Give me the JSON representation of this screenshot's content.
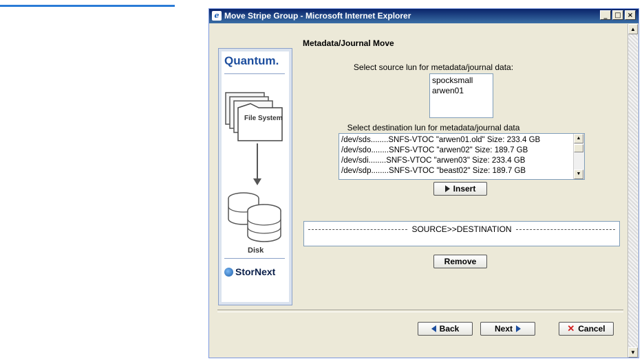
{
  "window": {
    "title": "Move Stripe Group - Microsoft Internet Explorer",
    "controls": {
      "minimize": "_",
      "maximize": "□",
      "close": "×"
    }
  },
  "sidebar": {
    "logo": "Quantum.",
    "file_system_label": "File System",
    "disk_label": "Disk",
    "brand": "StorNext"
  },
  "main": {
    "section_title": "Metadata/Journal Move",
    "source_label": "Select source lun for metadata/journal data:",
    "source_items": [
      "spocksmall",
      "arwen01"
    ],
    "destination_label": "Select destination lun for metadata/journal data",
    "destination_items": [
      "/dev/sds........SNFS-VTOC \"arwen01.old\" Size: 233.4 GB",
      "/dev/sdo........SNFS-VTOC \"arwen02\" Size: 189.7 GB",
      "/dev/sdi........SNFS-VTOC \"arwen03\" Size: 233.4 GB",
      "/dev/sdp........SNFS-VTOC \"beast02\" Size: 189.7 GB"
    ],
    "insert_label": "Insert",
    "mapping_header": "SOURCE>>DESTINATION",
    "remove_label": "Remove"
  },
  "footer": {
    "back_label": "Back",
    "next_label": "Next",
    "cancel_label": "Cancel"
  },
  "colors": {
    "titlebar": "#0a246a",
    "dialog_bg": "#ece9d8",
    "accent": "#2a7bd6",
    "brand_blue": "#1d4e9e",
    "cancel_x": "#d21c1c"
  }
}
